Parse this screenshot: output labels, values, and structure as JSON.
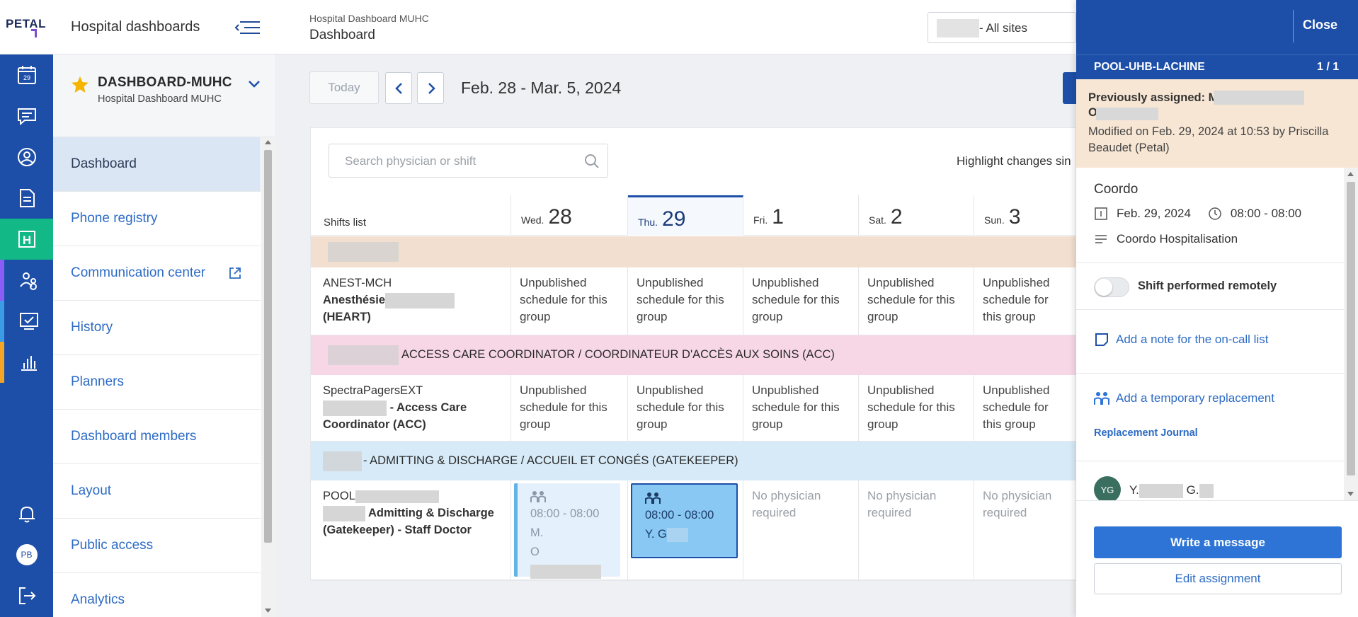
{
  "app": {
    "logo": "PETAL",
    "title": "Hospital dashboards"
  },
  "header": {
    "breadcrumb_parent": "Hospital Dashboard MUHC",
    "breadcrumb_current": "Dashboard",
    "site_select": "- All sites"
  },
  "rail": {
    "items": [
      {
        "icon": "calendar-icon",
        "label": "29"
      },
      {
        "icon": "chat-icon"
      },
      {
        "icon": "user-icon"
      },
      {
        "icon": "document-icon"
      },
      {
        "icon": "hospital-icon",
        "label": "H",
        "active_color": "#12b886"
      },
      {
        "icon": "team-icon",
        "accent": "#8b5cf6"
      },
      {
        "icon": "monitor-check-icon",
        "accent": "#3b9be6"
      },
      {
        "icon": "bar-chart-icon",
        "accent": "#f5a524"
      }
    ],
    "bottom": [
      {
        "icon": "bell-icon"
      },
      {
        "icon": "avatar",
        "label": "PB"
      },
      {
        "icon": "logout-icon"
      }
    ]
  },
  "sidebar": {
    "dashboard_name": "DASHBOARD-MUHC",
    "dashboard_sub": "Hospital Dashboard MUHC",
    "items": [
      {
        "label": "Dashboard",
        "active": true
      },
      {
        "label": "Phone registry"
      },
      {
        "label": "Communication center",
        "external": true
      },
      {
        "label": "History"
      },
      {
        "label": "Planners"
      },
      {
        "label": "Dashboard members"
      },
      {
        "label": "Layout"
      },
      {
        "label": "Public access"
      },
      {
        "label": "Analytics"
      }
    ]
  },
  "main": {
    "today_label": "Today",
    "date_range": "Feb. 28 - Mar. 5, 2024",
    "search_placeholder": "Search physician or shift",
    "highlight_label": "Highlight changes sin",
    "shifts_list_label": "Shifts list",
    "days": [
      {
        "dow": "Wed.",
        "num": "28"
      },
      {
        "dow": "Thu.",
        "num": "29",
        "today": true
      },
      {
        "dow": "Fri.",
        "num": "1"
      },
      {
        "dow": "Sat.",
        "num": "2"
      },
      {
        "dow": "Sun.",
        "num": "3"
      }
    ],
    "unpublished": "Unpublished schedule for this group",
    "no_physician": "No physician required",
    "groups": [
      {
        "band_text": "",
        "band_color": "#f2dfd0",
        "code": "ANEST-MCH",
        "name_prefix": "Anesthésie",
        "name_suffix": "(HEART)"
      },
      {
        "band_text": "ACCESS CARE COORDINATOR / COORDINATEUR D'ACCÈS AUX SOINS (ACC)",
        "band_color": "#f7d7e6",
        "code": "SpectraPagersEXT",
        "name_prefix": "- Access Care",
        "name_suffix": "Coordinator (ACC)"
      },
      {
        "band_text": "- ADMITTING & DISCHARGE / ACCUEIL ET CONGÉS (GATEKEEPER)",
        "band_color": "#d7eaf7",
        "code": "POOL",
        "name_prefix": "Admitting & Discharge",
        "name_suffix": "(Gatekeeper) - Staff Doctor"
      }
    ],
    "assignments": [
      {
        "time": "08:00 - 08:00",
        "line1": "M.",
        "line2": "O"
      },
      {
        "time": "08:00 - 08:00",
        "line1": "Y. G"
      }
    ]
  },
  "panel": {
    "close_label": "Close",
    "pool_name": "POOL-UHB-LACHINE",
    "pool_count": "1 / 1",
    "prev_assigned_label": "Previously assigned: M",
    "prev_assigned_line2": "O",
    "modified_text": "Modified on Feb. 29, 2024 at 10:53 by Priscilla Beaudet (Petal)",
    "shift_title": "Coordo",
    "shift_date": "Feb. 29, 2024",
    "shift_time": "08:00 - 08:00",
    "shift_desc": "Coordo Hospitalisation",
    "remote_label": "Shift performed remotely",
    "remote_on": false,
    "note_link": "Add a note for the on-call list",
    "replacement_link": "Add a temporary replacement",
    "journal_link": "Replacement Journal",
    "assignee_initials": "YG",
    "assignee_name": "Y.",
    "assignee_name_end": "G.",
    "write_message": "Write a message",
    "edit_assignment": "Edit assignment"
  },
  "colors": {
    "primary": "#1e4fa8",
    "link": "#2d6bc4",
    "accent_green": "#12b886"
  }
}
